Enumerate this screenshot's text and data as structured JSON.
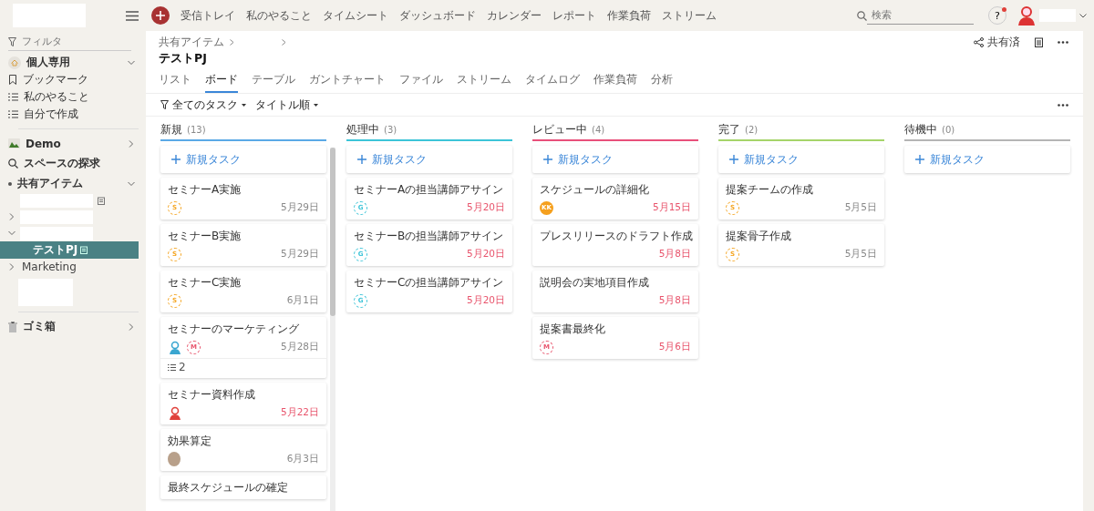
{
  "topbar": {
    "nav": [
      "受信トレイ",
      "私のやること",
      "タイムシート",
      "ダッシュボード",
      "カレンダー",
      "レポート",
      "作業負荷",
      "ストリーム"
    ],
    "search": {
      "placeholder": "検索"
    },
    "help": {
      "label": "?",
      "notification": true
    }
  },
  "sidebar": {
    "filter": {
      "placeholder": "フィルタ"
    },
    "personal": {
      "label": "個人専用",
      "expanded": true,
      "items": [
        {
          "label": "ブックマーク",
          "kind": "bookmark"
        },
        {
          "label": "私のやること",
          "kind": "list"
        },
        {
          "label": "自分で作成",
          "kind": "list"
        }
      ]
    },
    "spaces": [
      {
        "label": "Demo",
        "kind": "space",
        "expanded": false
      },
      {
        "label": "スペースの探求",
        "kind": "search"
      },
      {
        "label": "共有アイテム",
        "kind": "shared",
        "expanded": true
      }
    ],
    "tree": [
      {
        "kind": "redacted",
        "doc": true
      },
      {
        "kind": "redacted",
        "expanded": false
      },
      {
        "kind": "redacted",
        "expanded": true,
        "children": [
          {
            "kind": "item",
            "label": "テストPJ",
            "doc": true,
            "selected": true
          }
        ]
      },
      {
        "kind": "item",
        "label": "Marketing",
        "expanded": false,
        "selected": false
      },
      {
        "kind": "block"
      }
    ],
    "trash": {
      "label": "ゴミ箱",
      "expanded": false
    }
  },
  "header": {
    "breadcrumb": [
      "共有アイテム"
    ],
    "title": "テストPJ",
    "share": "共有済",
    "tabs": [
      {
        "label": "リスト",
        "selected": false
      },
      {
        "label": "ボード",
        "selected": true
      },
      {
        "label": "テーブル",
        "selected": false
      },
      {
        "label": "ガントチャート",
        "selected": false
      },
      {
        "label": "ファイル",
        "selected": false
      },
      {
        "label": "ストリーム",
        "selected": false
      },
      {
        "label": "タイムログ",
        "selected": false
      },
      {
        "label": "作業負荷",
        "selected": false
      },
      {
        "label": "分析",
        "selected": false
      }
    ],
    "filters": [
      "全てのタスク",
      "タイトル順"
    ]
  },
  "board": {
    "columns": [
      {
        "title": "新規",
        "count": "(13)",
        "color": "#5aa9e6",
        "add_label": "新規タスク",
        "cards": [
          {
            "title": "セミナーA実施",
            "date": "5月29日",
            "overdue": false,
            "avatars": [
              {
                "kind": "initial",
                "text": "S",
                "color": "#f5a623"
              }
            ]
          },
          {
            "title": "セミナーB実施",
            "date": "5月29日",
            "overdue": false,
            "avatars": [
              {
                "kind": "initial",
                "text": "S",
                "color": "#f5a623"
              }
            ]
          },
          {
            "title": "セミナーC実施",
            "date": "6月1日",
            "overdue": false,
            "avatars": [
              {
                "kind": "initial",
                "text": "S",
                "color": "#f5a623"
              }
            ]
          },
          {
            "title": "セミナーのマーケティング",
            "date": "5月28日",
            "overdue": false,
            "avatars": [
              {
                "kind": "person",
                "color": "#3aa6d0"
              },
              {
                "kind": "initial",
                "text": "M",
                "color": "#e8536b"
              }
            ],
            "subtasks": "2"
          },
          {
            "title": "セミナー資料作成",
            "date": "5月22日",
            "overdue": true,
            "avatars": [
              {
                "kind": "person",
                "color": "#e0403a"
              }
            ]
          },
          {
            "title": "効果算定",
            "date": "6月3日",
            "overdue": false,
            "avatars": [
              {
                "kind": "photo"
              }
            ]
          },
          {
            "title": "最終スケジュールの確定"
          }
        ]
      },
      {
        "title": "処理中",
        "count": "(3)",
        "color": "#3cc4d8",
        "add_label": "新規タスク",
        "cards": [
          {
            "title": "セミナーAの担当講師アサイン",
            "date": "5月20日",
            "overdue": true,
            "avatars": [
              {
                "kind": "initial",
                "text": "G",
                "color": "#3cc4d8"
              }
            ]
          },
          {
            "title": "セミナーBの担当講師アサイン",
            "date": "5月20日",
            "overdue": true,
            "avatars": [
              {
                "kind": "initial",
                "text": "G",
                "color": "#3cc4d8"
              }
            ]
          },
          {
            "title": "セミナーCの担当講師アサイン",
            "date": "5月20日",
            "overdue": true,
            "avatars": [
              {
                "kind": "initial",
                "text": "G",
                "color": "#3cc4d8"
              }
            ]
          }
        ]
      },
      {
        "title": "レビュー中",
        "count": "(4)",
        "color": "#e8507a",
        "add_label": "新規タスク",
        "cards": [
          {
            "title": "スケジュールの詳細化",
            "date": "5月15日",
            "overdue": true,
            "avatars": [
              {
                "kind": "solid",
                "text": "KK",
                "color": "#f5a01e"
              }
            ]
          },
          {
            "title": "プレスリリースのドラフト作成",
            "date": "5月8日",
            "overdue": true
          },
          {
            "title": "説明会の実地項目作成",
            "date": "5月8日",
            "overdue": true
          },
          {
            "title": "提案書最終化",
            "date": "5月6日",
            "overdue": true,
            "avatars": [
              {
                "kind": "initial",
                "text": "M",
                "color": "#e8536b"
              }
            ]
          }
        ]
      },
      {
        "title": "完了",
        "count": "(2)",
        "color": "#a5d46a",
        "add_label": "新規タスク",
        "cards": [
          {
            "title": "提案チームの作成",
            "date": "5月5日",
            "overdue": false,
            "avatars": [
              {
                "kind": "initial",
                "text": "S",
                "color": "#f5a623"
              }
            ]
          },
          {
            "title": "提案骨子作成",
            "date": "5月5日",
            "overdue": false,
            "avatars": [
              {
                "kind": "initial",
                "text": "S",
                "color": "#f5a623"
              }
            ]
          }
        ]
      },
      {
        "title": "待機中",
        "count": "(0)",
        "color": "#b5b5b5",
        "add_label": "新規タスク"
      }
    ]
  }
}
